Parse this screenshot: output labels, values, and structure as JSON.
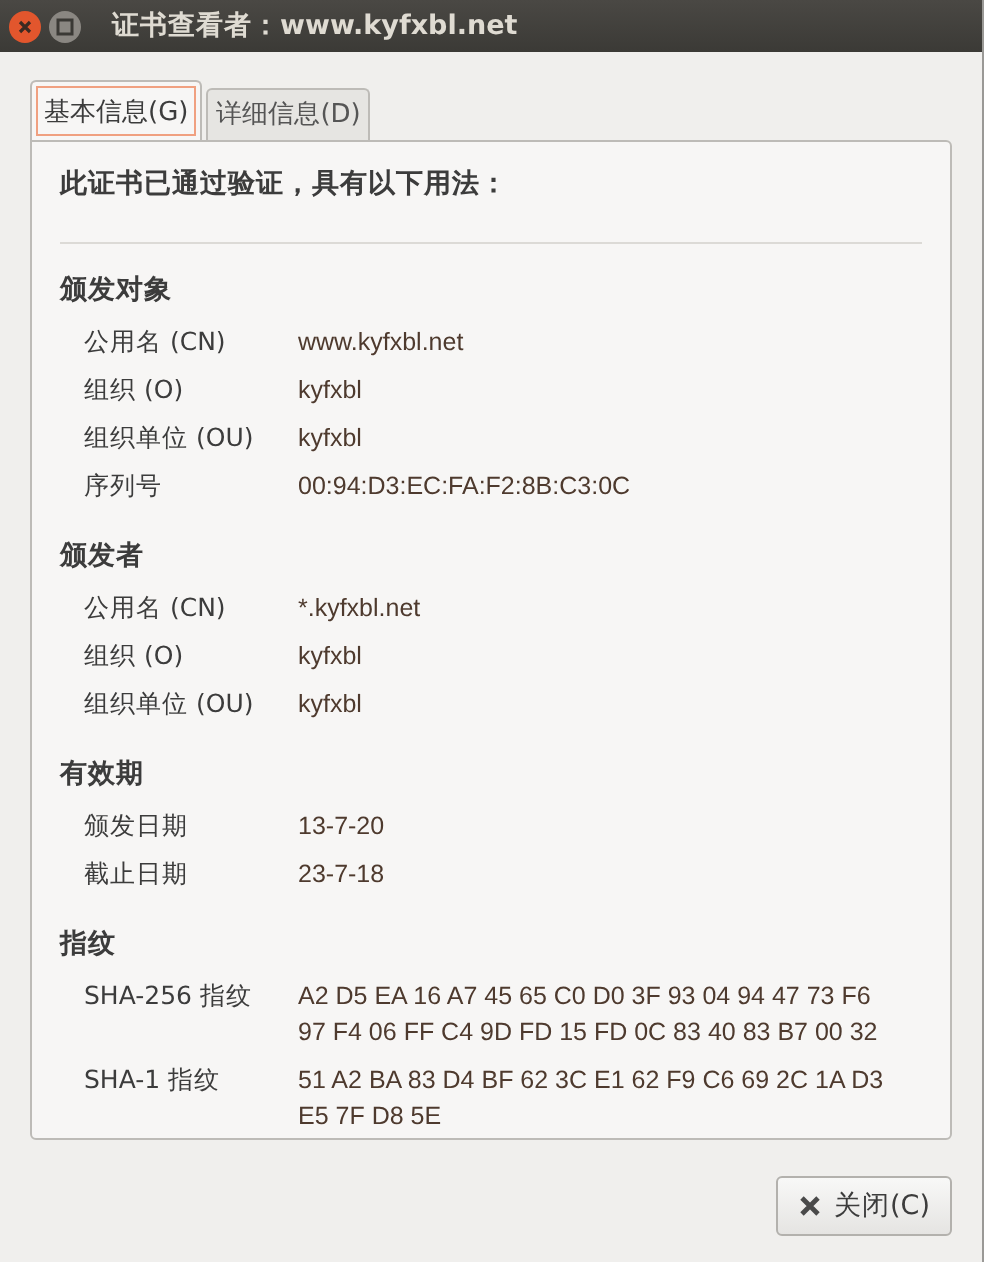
{
  "window": {
    "title": "证书查看者：www.kyfxbl.net"
  },
  "tabs": [
    {
      "label": "基本信息(G)",
      "selected": true
    },
    {
      "label": "详细信息(D)",
      "selected": false
    }
  ],
  "intro": "此证书已通过验证，具有以下用法：",
  "sections": [
    {
      "heading": "颁发对象",
      "rows": [
        {
          "label": "公用名 (CN)",
          "value": "www.kyfxbl.net"
        },
        {
          "label": "组织 (O)",
          "value": "kyfxbl"
        },
        {
          "label": "组织单位 (OU)",
          "value": "kyfxbl"
        },
        {
          "label": "序列号",
          "value": "00:94:D3:EC:FA:F2:8B:C3:0C"
        }
      ]
    },
    {
      "heading": "颁发者",
      "rows": [
        {
          "label": "公用名 (CN)",
          "value": "*.kyfxbl.net"
        },
        {
          "label": "组织 (O)",
          "value": "kyfxbl"
        },
        {
          "label": "组织单位 (OU)",
          "value": "kyfxbl"
        }
      ]
    },
    {
      "heading": "有效期",
      "rows": [
        {
          "label": "颁发日期",
          "value": "13-7-20"
        },
        {
          "label": "截止日期",
          "value": "23-7-18"
        }
      ]
    },
    {
      "heading": "指纹",
      "rows": [
        {
          "label": "SHA-256 指纹",
          "value": "A2 D5 EA 16 A7 45 65 C0 D0 3F 93 04 94 47 73 F6\n97 F4 06 FF C4 9D FD 15 FD 0C 83 40 83 B7 00 32"
        },
        {
          "label": "SHA-1 指纹",
          "value": "51 A2 BA 83 D4 BF 62 3C E1 62 F9 C6 69 2C 1A D3\nE5 7F D8 5E"
        }
      ]
    }
  ],
  "close_button": {
    "label": "关闭(C)"
  }
}
